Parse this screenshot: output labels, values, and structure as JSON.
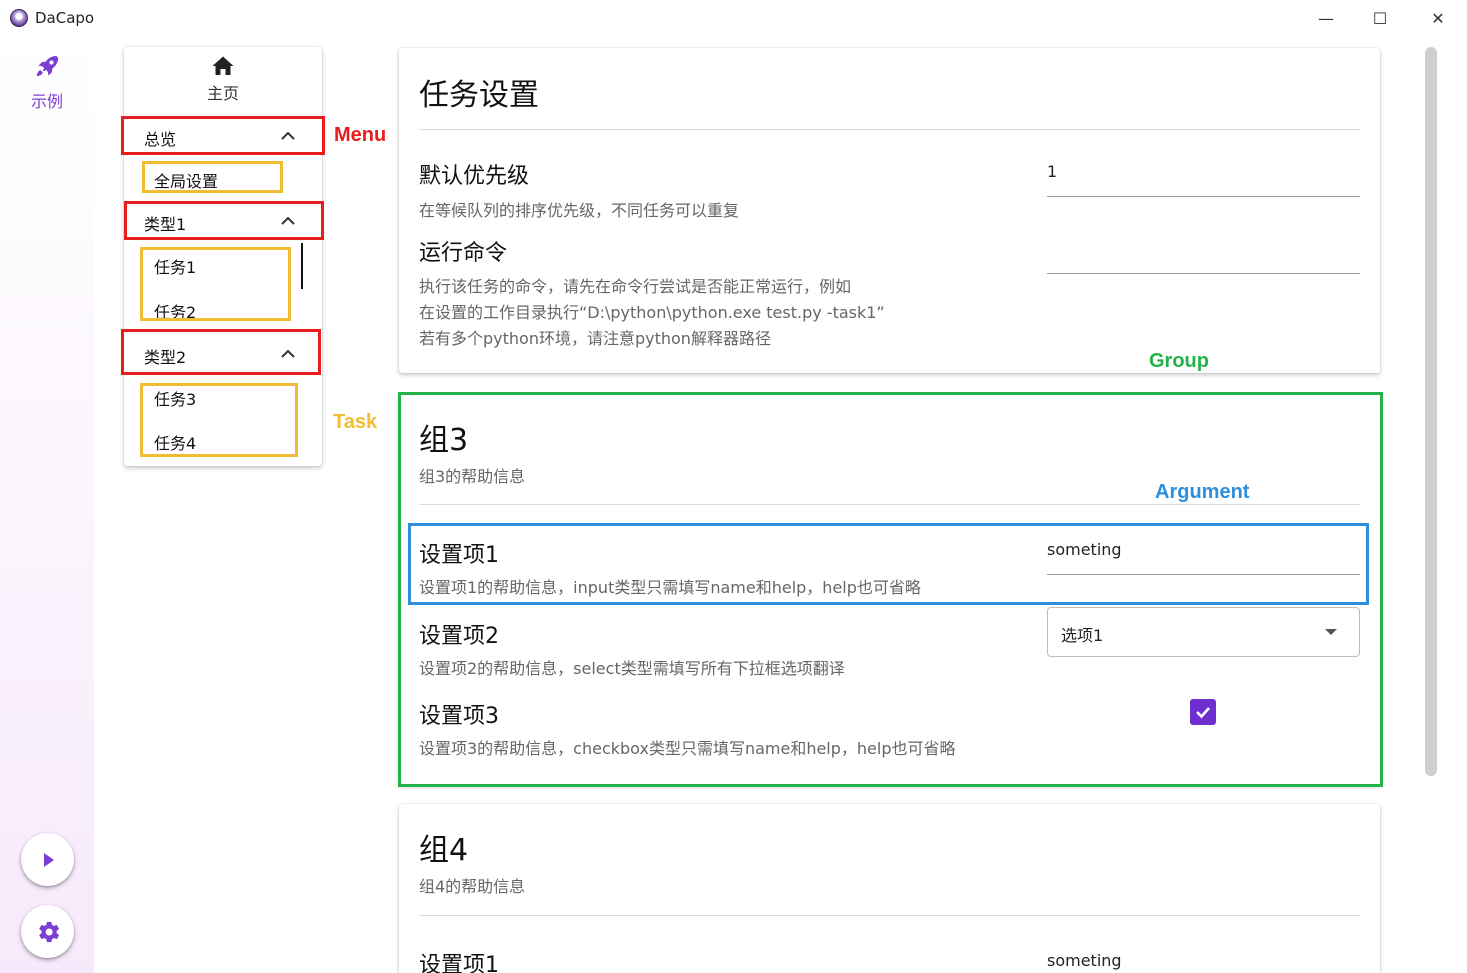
{
  "window": {
    "title": "DaCapo",
    "minimize_glyph": "—",
    "maximize_glyph": "☐",
    "close_glyph": "✕"
  },
  "rail": {
    "item_label": "示例",
    "item_icon": "rocket-icon",
    "accent_color": "#7b3fd2",
    "run_button_icon": "play-icon",
    "settings_button_icon": "gear-icon"
  },
  "nav": {
    "home_label": "主页",
    "home_icon": "home-icon",
    "menus": [
      {
        "label": "总览",
        "expanded": true,
        "tasks": [
          "全局设置"
        ]
      },
      {
        "label": "类型1",
        "expanded": true,
        "tasks": [
          "任务1",
          "任务2"
        ]
      },
      {
        "label": "类型2",
        "expanded": true,
        "tasks": [
          "任务3",
          "任务4"
        ]
      }
    ]
  },
  "annotations": {
    "menu": "Menu",
    "task": "Task",
    "group": "Group",
    "argument": "Argument",
    "colors": {
      "menu": "#e81e1e",
      "task": "#f0bd32",
      "group": "#25b24a",
      "argument": "#2e8fdc"
    }
  },
  "main": {
    "task_settings": {
      "title": "任务设置",
      "args": [
        {
          "name": "默认优先级",
          "value": "1",
          "help": "在等候队列的排序优先级，不同任务可以重复"
        },
        {
          "name": "运行命令",
          "value": "",
          "help_lines": [
            "执行该任务的命令，请先在命令行尝试是否能正常运行，例如",
            "在设置的工作目录执行“D:\\python\\python.exe test.py -task1”",
            "若有多个python环境，请注意python解释器路径"
          ]
        }
      ]
    },
    "group3": {
      "title": "组3",
      "help": "组3的帮助信息",
      "args": [
        {
          "name": "设置项1",
          "type": "input",
          "value": "someting",
          "help": "设置项1的帮助信息，input类型只需填写name和help，help也可省略"
        },
        {
          "name": "设置项2",
          "type": "select",
          "value": "选项1",
          "help": "设置项2的帮助信息，select类型需填写所有下拉框选项翻译"
        },
        {
          "name": "设置项3",
          "type": "checkbox",
          "checked": true,
          "help": "设置项3的帮助信息，checkbox类型只需填写name和help，help也可省略"
        }
      ]
    },
    "group4": {
      "title": "组4",
      "help": "组4的帮助信息",
      "args": [
        {
          "name": "设置项1",
          "value": "someting"
        }
      ]
    }
  }
}
